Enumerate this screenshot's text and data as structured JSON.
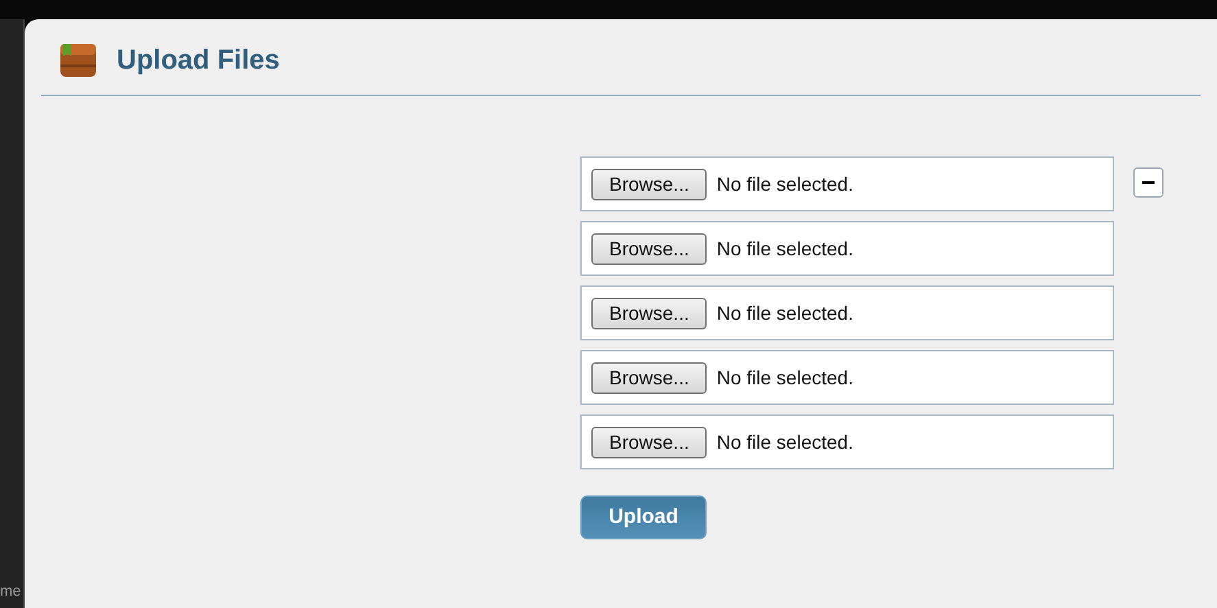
{
  "background_text": "me",
  "dialog": {
    "title": "Upload Files",
    "file_rows": [
      {
        "button": "Browse...",
        "status": "No file selected."
      },
      {
        "button": "Browse...",
        "status": "No file selected."
      },
      {
        "button": "Browse...",
        "status": "No file selected."
      },
      {
        "button": "Browse...",
        "status": "No file selected."
      },
      {
        "button": "Browse...",
        "status": "No file selected."
      }
    ],
    "remove_button": "−",
    "upload_button": "Upload"
  }
}
